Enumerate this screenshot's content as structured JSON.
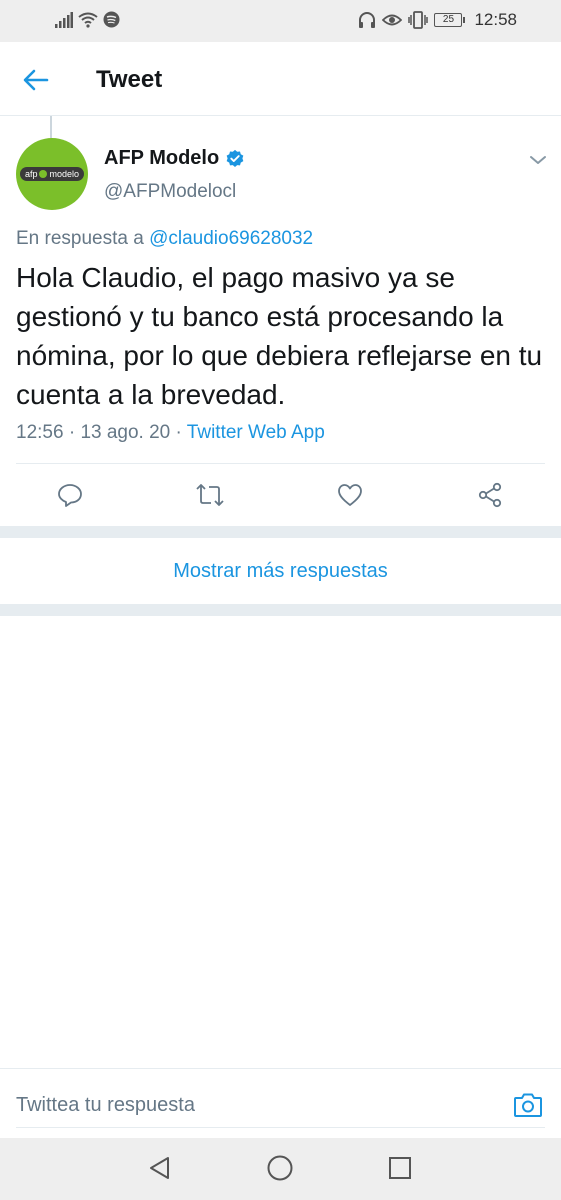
{
  "status_bar": {
    "time": "12:58",
    "battery": "25",
    "icons": [
      "signal-icon",
      "wifi-icon",
      "spotify-icon",
      "headphones-icon",
      "eye-icon",
      "vibrate-icon",
      "battery-icon"
    ]
  },
  "header": {
    "title": "Tweet",
    "back_icon": "arrow-left-icon"
  },
  "tweet": {
    "avatar_logo_left": "afp",
    "avatar_logo_right": "modelo",
    "display_name": "AFP Modelo",
    "handle": "@AFPModelocl",
    "reply_prefix": "En respuesta a",
    "reply_mention": "@claudio69628032",
    "text": "Hola Claudio, el pago masivo ya se gestionó y tu banco está procesando la nómina, por lo que debiera reflejarse en tu cuenta a la brevedad.",
    "time": "12:56",
    "date": "13 ago. 20",
    "source": "Twitter Web App",
    "separator": "·"
  },
  "actions": [
    "reply-icon",
    "retweet-icon",
    "like-icon",
    "share-icon"
  ],
  "show_more": "Mostrar más respuestas",
  "composer": {
    "placeholder": "Twittea tu respuesta"
  },
  "colors": {
    "accent": "#1b95e0",
    "secondary_text": "#657786",
    "avatar_green": "#7bbf2a",
    "divider": "#e6ecf0"
  }
}
